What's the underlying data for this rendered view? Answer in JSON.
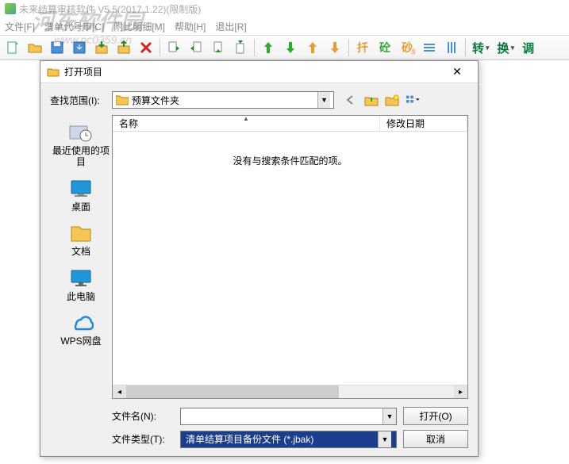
{
  "app": {
    "title": "未来结算审核软件 V5.5(2017.1.22)(限制版)"
  },
  "watermark": {
    "main": "河东软件园",
    "sub": "www.pc0359.cn"
  },
  "menu": {
    "items": [
      "文件[F]",
      "清单代号审[C]",
      "附比明细[M]",
      "帮助[H]",
      "退出[R]"
    ]
  },
  "toolbar": {
    "text_buttons": [
      "转",
      "换",
      "调"
    ]
  },
  "dialog": {
    "title": "打开项目",
    "look_in_label": "查找范围(I):",
    "look_in_value": "预算文件夹",
    "places": [
      {
        "key": "recent",
        "label": "最近使用的项目"
      },
      {
        "key": "desktop",
        "label": "桌面"
      },
      {
        "key": "documents",
        "label": "文档"
      },
      {
        "key": "thispc",
        "label": "此电脑"
      },
      {
        "key": "wps",
        "label": "WPS网盘"
      }
    ],
    "columns": {
      "name": "名称",
      "date": "修改日期"
    },
    "empty_message": "没有与搜索条件匹配的项。",
    "filename_label": "文件名(N):",
    "filename_value": "",
    "filetype_label": "文件类型(T):",
    "filetype_value": "清单结算项目备份文件 (*.jbak)",
    "open_btn": "打开(O)",
    "cancel_btn": "取消"
  }
}
